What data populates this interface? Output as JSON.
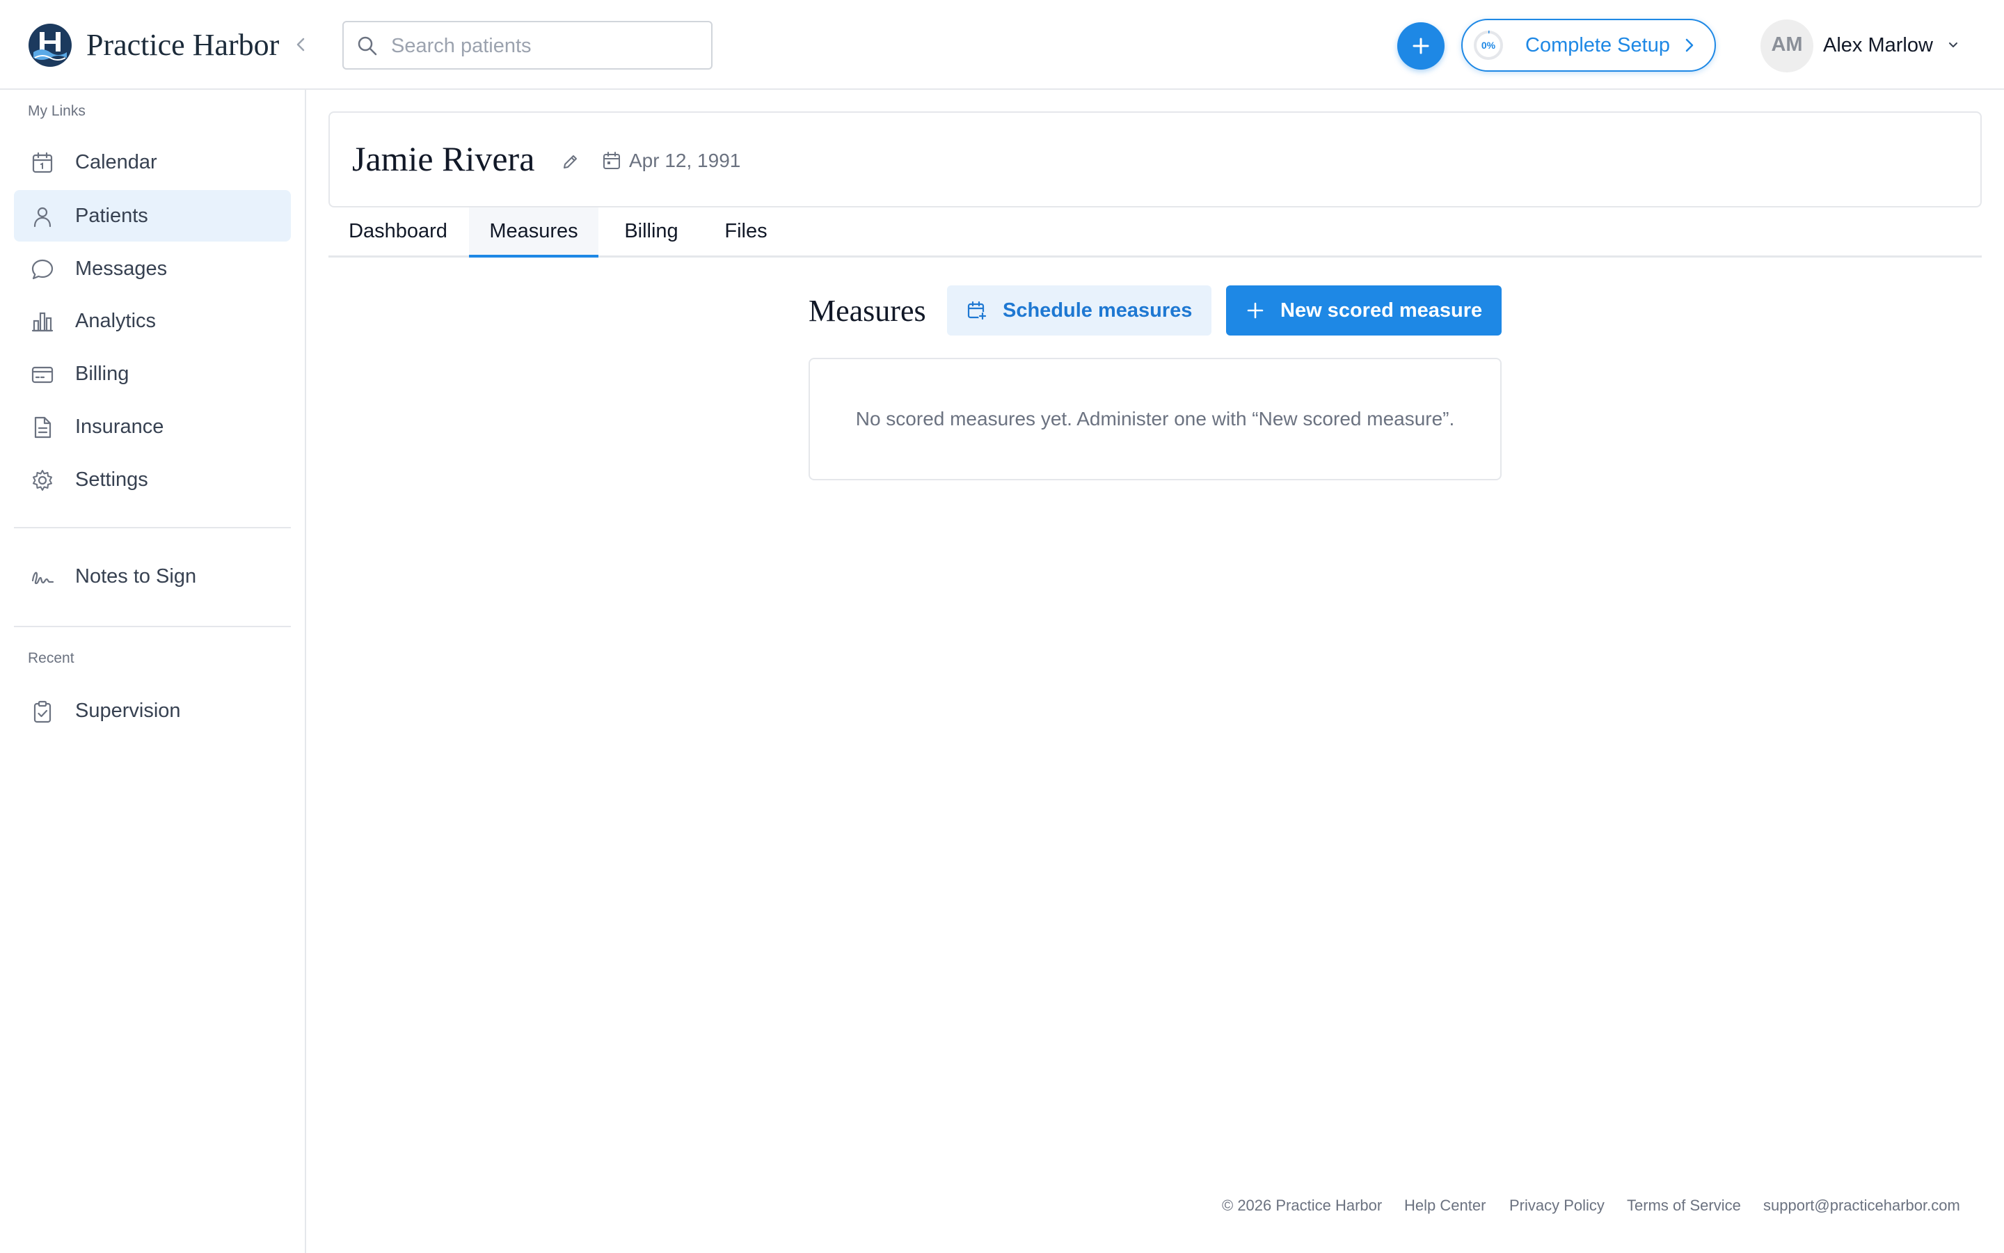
{
  "header": {
    "brand": "Practice Harbor",
    "search_placeholder": "Search patients",
    "setup": {
      "label": "Complete Setup",
      "progress_text": "0%",
      "progress": 0
    },
    "user": {
      "initials": "AM",
      "name": "Alex Marlow"
    }
  },
  "sidebar": {
    "my_links_label": "My Links",
    "items": [
      {
        "label": "Calendar",
        "icon": "calendar-icon",
        "active": false
      },
      {
        "label": "Patients",
        "icon": "person-icon",
        "active": true
      },
      {
        "label": "Messages",
        "icon": "message-bubble-icon",
        "active": false
      },
      {
        "label": "Analytics",
        "icon": "bar-chart-icon",
        "active": false
      },
      {
        "label": "Billing",
        "icon": "credit-card-icon",
        "active": false
      },
      {
        "label": "Insurance",
        "icon": "document-icon",
        "active": false
      },
      {
        "label": "Settings",
        "icon": "gear-icon",
        "active": false
      }
    ],
    "notes_to_sign": {
      "label": "Notes to Sign",
      "icon": "signature-icon"
    },
    "recent_label": "Recent",
    "recent_items": [
      {
        "label": "Supervision",
        "icon": "clipboard-check-icon"
      }
    ]
  },
  "patient": {
    "name": "Jamie Rivera",
    "dob": "Apr 12, 1991"
  },
  "tabs": [
    {
      "label": "Dashboard",
      "active": false
    },
    {
      "label": "Measures",
      "active": true
    },
    {
      "label": "Billing",
      "active": false
    },
    {
      "label": "Files",
      "active": false
    }
  ],
  "measures": {
    "title": "Measures",
    "schedule_label": "Schedule measures",
    "new_label": "New scored measure",
    "empty_text": "No scored measures yet. Administer one with “New scored measure”."
  },
  "footer": {
    "copyright": "© 2026 Practice Harbor",
    "links": [
      "Help Center",
      "Privacy Policy",
      "Terms of Service"
    ],
    "email": "support@practiceharbor.com"
  },
  "colors": {
    "accent": "#1e88e5",
    "active_nav_bg": "#e8f2fc",
    "brand_navy": "#1c3a5e"
  }
}
